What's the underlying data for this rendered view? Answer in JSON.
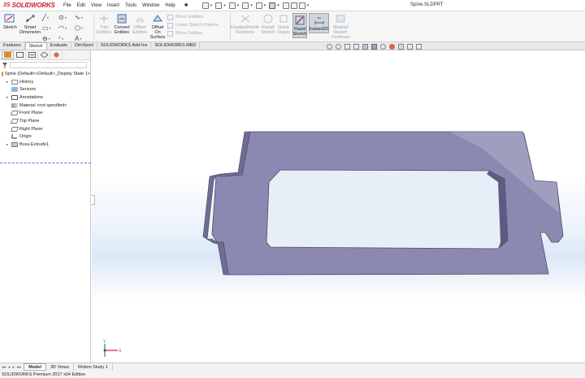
{
  "app": {
    "logo_ds": "3S",
    "logo_text": "SOLIDWORKS",
    "document_title": "Spine.SLDPRT",
    "menus": [
      "File",
      "Edit",
      "View",
      "Insert",
      "Tools",
      "Window",
      "Help"
    ]
  },
  "ribbon": {
    "sketch": "Sketch",
    "smart_dimension": "Smart Dimension",
    "trim_entities": "Trim Entities",
    "convert_entities": "Convert Entities",
    "offset_entities": "Offset Entities",
    "offset_on_surface": "Offset On Surface",
    "mirror_entities": "Mirror Entities",
    "linear_sketch_pattern": "Linear Sketch Pattern",
    "move_entities": "Move Entities",
    "display_delete_relations": "Display/Delete Relations",
    "repair_sketch": "Repair Sketch",
    "quick_snaps": "Quick Snaps",
    "rapid_sketch": "Rapid Sketch",
    "instant2d": "Instant2D",
    "shaded_sketch_contours": "Shaded Sketch Contours"
  },
  "tabs": [
    "Features",
    "Sketch",
    "Evaluate",
    "DimXpert",
    "SOLIDWORKS Add-Ins",
    "SOLIDWORKS MBD"
  ],
  "active_tab": "Sketch",
  "tree": {
    "root": "Spine  (Default<<Default>_Display State 1>",
    "items": [
      {
        "label": "History",
        "expand": true
      },
      {
        "label": "Sensors",
        "expand": false
      },
      {
        "label": "Annotations",
        "expand": true
      },
      {
        "label": "Material <not specified>",
        "expand": false
      },
      {
        "label": "Front Plane",
        "expand": false
      },
      {
        "label": "Top Plane",
        "expand": false
      },
      {
        "label": "Right Plane",
        "expand": false
      },
      {
        "label": "Origin",
        "expand": false
      },
      {
        "label": "Boss-Extrude1",
        "expand": true
      }
    ]
  },
  "triad": {
    "x": "X",
    "y": "Y"
  },
  "bottom_tabs": [
    "Model",
    "3D Views",
    "Motion Study 1"
  ],
  "active_bottom_tab": "Model",
  "status": "SOLIDWORKS Premium 2017 x64 Edition",
  "colors": {
    "part_face": "#8a88b0",
    "part_edge": "#4a4a5e",
    "brand_red": "#d0202a"
  }
}
